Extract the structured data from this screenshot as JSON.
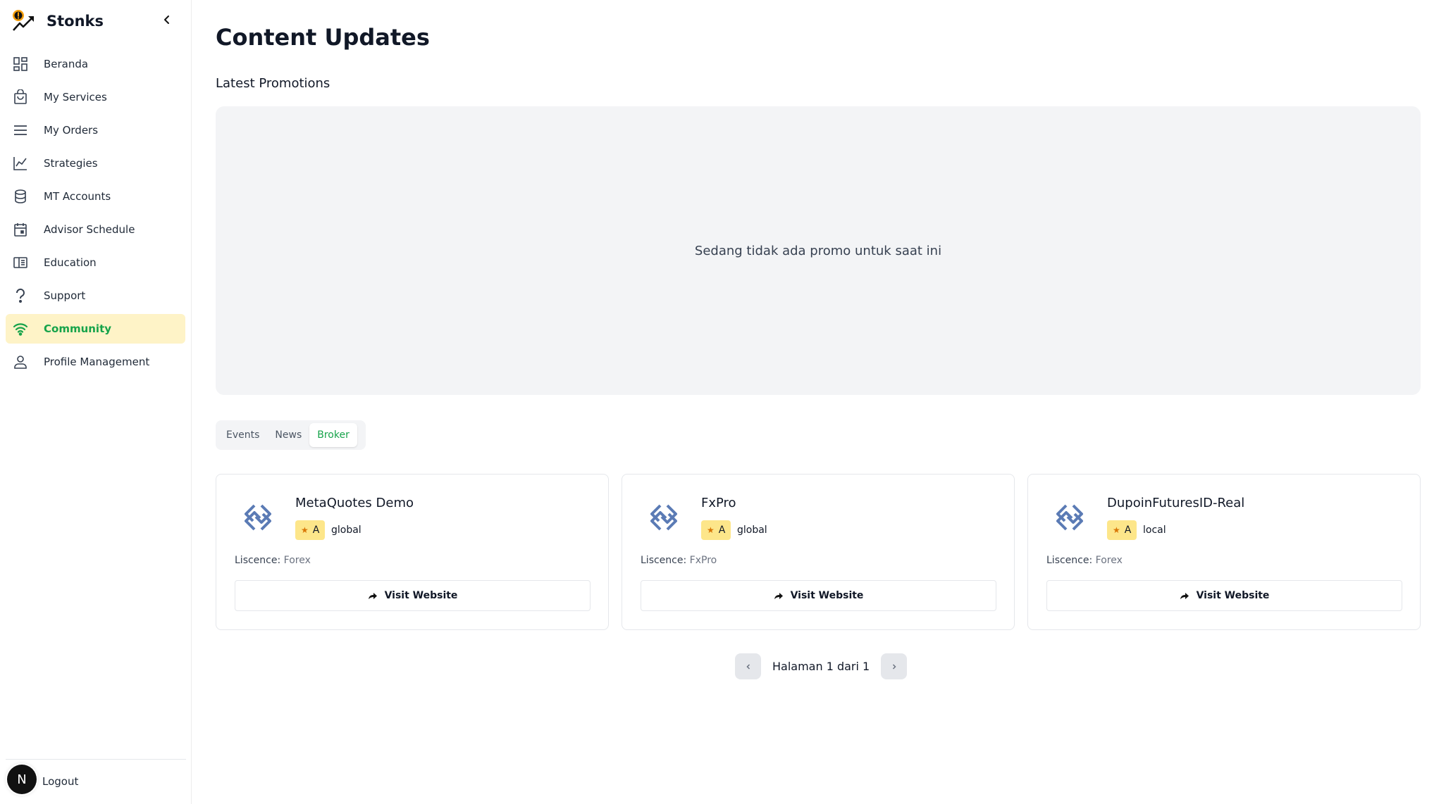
{
  "brand": {
    "name": "Stonks"
  },
  "sidebar": {
    "items": [
      {
        "label": "Beranda",
        "icon": "dashboard-icon"
      },
      {
        "label": "My Services",
        "icon": "shopping-bag-icon"
      },
      {
        "label": "My Orders",
        "icon": "menu-lines-icon"
      },
      {
        "label": "Strategies",
        "icon": "line-chart-icon"
      },
      {
        "label": "MT Accounts",
        "icon": "database-icon"
      },
      {
        "label": "Advisor Schedule",
        "icon": "calendar-icon"
      },
      {
        "label": "Education",
        "icon": "book-icon"
      },
      {
        "label": "Support",
        "icon": "question-icon"
      },
      {
        "label": "Community",
        "icon": "wifi-icon",
        "active": true
      },
      {
        "label": "Profile Management",
        "icon": "user-icon"
      }
    ],
    "logout_label": "Logout",
    "avatar_letter": "N"
  },
  "main": {
    "title": "Content Updates",
    "promotions": {
      "title": "Latest Promotions",
      "empty_text": "Sedang tidak ada promo untuk saat ini"
    },
    "tabs": [
      {
        "label": "Events"
      },
      {
        "label": "News"
      },
      {
        "label": "Broker",
        "active": true
      }
    ],
    "brokers": [
      {
        "name": "MetaQuotes Demo",
        "rating": "A",
        "scope": "global",
        "licence_label": "Liscence:",
        "licence_value": "Forex",
        "button_label": "Visit Website"
      },
      {
        "name": "FxPro",
        "rating": "A",
        "scope": "global",
        "licence_label": "Liscence:",
        "licence_value": "FxPro",
        "button_label": "Visit Website"
      },
      {
        "name": "DupoinFuturesID-Real",
        "rating": "A",
        "scope": "local",
        "licence_label": "Liscence:",
        "licence_value": "Forex",
        "button_label": "Visit Website"
      }
    ],
    "pagination": {
      "text": "Halaman 1 dari 1"
    }
  },
  "colors": {
    "accent": "#16a34a",
    "active_bg": "#fef3c7",
    "badge_bg": "#fde68a",
    "promo_bg": "#f3f4f6"
  }
}
